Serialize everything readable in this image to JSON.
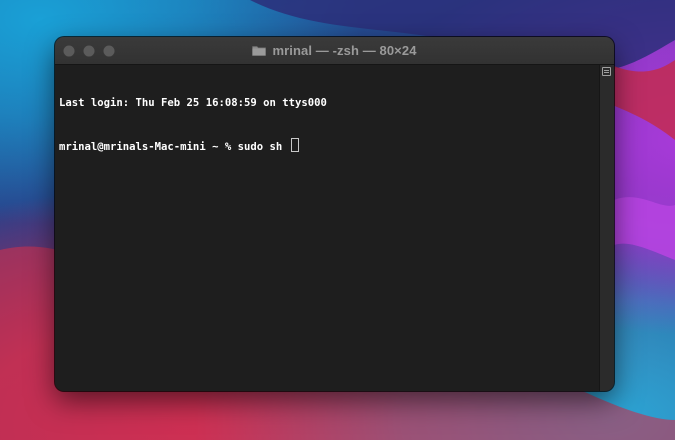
{
  "window": {
    "title": "mrinal — -zsh — 80×24",
    "title_icon": "folder-icon",
    "traffic_lights": [
      "close",
      "minimize",
      "zoom"
    ]
  },
  "terminal": {
    "lines": [
      "Last login: Thu Feb 25 16:08:59 on ttys000",
      "mrinal@mrinals-Mac-mini ~ % sudo sh"
    ]
  },
  "colors": {
    "terminal_bg": "#1e1e1e",
    "terminal_fg": "#ffffff",
    "titlebar_bg": "#363636",
    "title_text": "#9a9a9a"
  }
}
